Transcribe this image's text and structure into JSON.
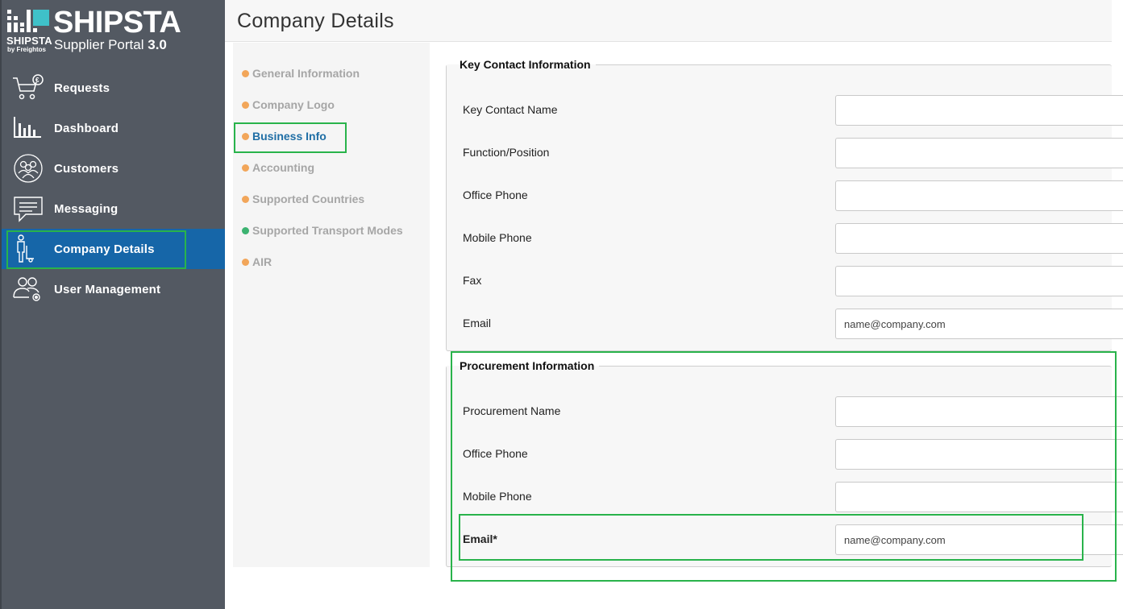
{
  "app": {
    "brand_big": "SHIPSTA",
    "brand_small": "SHIPSTA",
    "brand_by": "by Freightos",
    "portal_text": "Supplier Portal",
    "portal_version": "3.0"
  },
  "sidebar": {
    "items": [
      {
        "label": "Requests",
        "icon": "cart-euro-icon"
      },
      {
        "label": "Dashboard",
        "icon": "bar-chart-icon"
      },
      {
        "label": "Customers",
        "icon": "customers-icon"
      },
      {
        "label": "Messaging",
        "icon": "chat-icon"
      },
      {
        "label": "Company Details",
        "icon": "person-luggage-icon",
        "active": true
      },
      {
        "label": "User Management",
        "icon": "users-gear-icon"
      }
    ]
  },
  "page": {
    "title": "Company Details"
  },
  "subnav": {
    "items": [
      {
        "label": "General Information",
        "status": "orange"
      },
      {
        "label": "Company Logo",
        "status": "orange"
      },
      {
        "label": "Business Info",
        "status": "orange",
        "active": true
      },
      {
        "label": "Accounting",
        "status": "orange"
      },
      {
        "label": "Supported Countries",
        "status": "orange"
      },
      {
        "label": "Supported Transport Modes",
        "status": "green"
      },
      {
        "label": "AIR",
        "status": "orange"
      }
    ]
  },
  "key_contact": {
    "legend": "Key Contact Information",
    "fields": [
      {
        "label": "Key Contact Name",
        "value": "",
        "placeholder": ""
      },
      {
        "label": "Function/Position",
        "value": "",
        "placeholder": ""
      },
      {
        "label": "Office Phone",
        "value": "",
        "placeholder": ""
      },
      {
        "label": "Mobile Phone",
        "value": "",
        "placeholder": ""
      },
      {
        "label": "Fax",
        "value": "",
        "placeholder": ""
      },
      {
        "label": "Email",
        "value": "",
        "placeholder": "name@company.com"
      }
    ]
  },
  "procurement": {
    "legend": "Procurement Information",
    "fields": [
      {
        "label": "Procurement Name",
        "value": "",
        "placeholder": ""
      },
      {
        "label": "Office Phone",
        "value": "",
        "placeholder": ""
      },
      {
        "label": "Mobile Phone",
        "value": "",
        "placeholder": ""
      },
      {
        "label": "Email*",
        "value": "",
        "placeholder": "name@company.com"
      }
    ]
  },
  "colors": {
    "sidebar_bg": "#535962",
    "active_nav": "#1666a8",
    "highlight": "#29b34b",
    "dot_orange": "#f2a65a",
    "dot_green": "#3cb371",
    "active_link": "#1f6ea5"
  }
}
